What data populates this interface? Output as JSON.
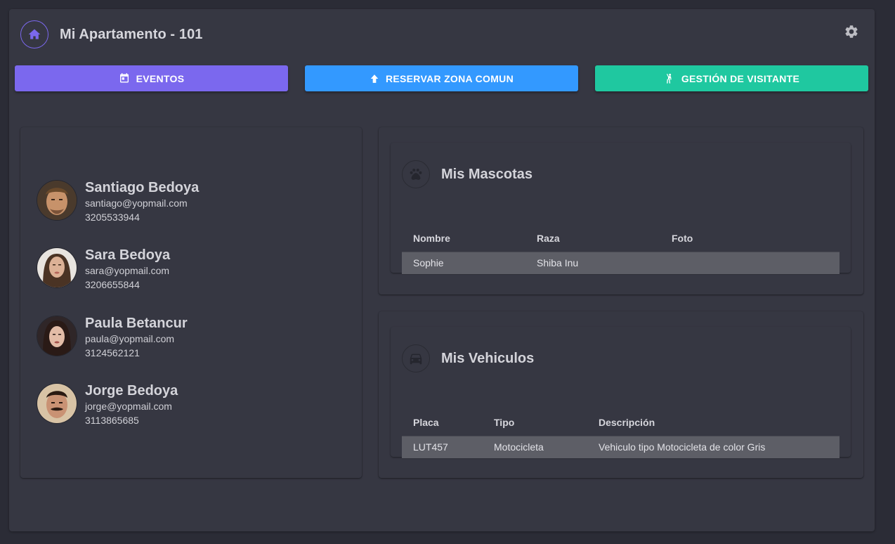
{
  "header": {
    "title": "Mi Apartamento - 101",
    "home_icon": "home-icon",
    "settings_icon": "gear-icon"
  },
  "actions": [
    {
      "label": "EVENTOS",
      "icon": "calendar-icon",
      "color": "#7b68ee"
    },
    {
      "label": "RESERVAR ZONA COMUN",
      "icon": "house-arrow-icon",
      "color": "#3399ff"
    },
    {
      "label": "GESTIÓN DE VISITANTE",
      "icon": "person-waving-icon",
      "color": "#1fc8a0"
    }
  ],
  "residents": [
    {
      "name": "Santiago Bedoya",
      "email": "santiago@yopmail.com",
      "phone": "3205533944"
    },
    {
      "name": "Sara Bedoya",
      "email": "sara@yopmail.com",
      "phone": "3206655844"
    },
    {
      "name": "Paula Betancur",
      "email": "paula@yopmail.com",
      "phone": "3124562121"
    },
    {
      "name": "Jorge Bedoya",
      "email": "jorge@yopmail.com",
      "phone": "3113865685"
    }
  ],
  "pets": {
    "title": "Mis Mascotas",
    "icon": "paw-icon",
    "columns": [
      "Nombre",
      "Raza",
      "Foto"
    ],
    "rows": [
      [
        "Sophie",
        "Shiba Inu",
        ""
      ]
    ]
  },
  "vehicles": {
    "title": "Mis Vehiculos",
    "icon": "car-icon",
    "columns": [
      "Placa",
      "Tipo",
      "Descripción"
    ],
    "rows": [
      [
        "LUT457",
        "Motocicleta",
        "Vehiculo tipo Motocicleta de color Gris"
      ]
    ]
  }
}
